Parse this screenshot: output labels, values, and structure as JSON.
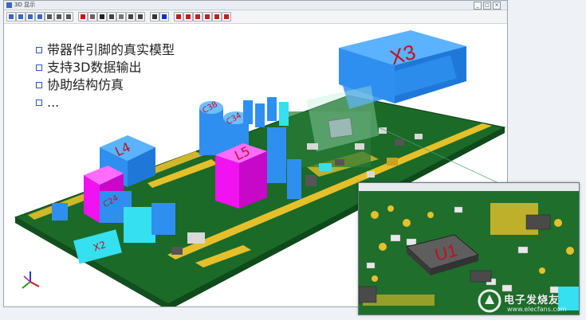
{
  "window": {
    "title": "3D 显示",
    "controls": [
      "_",
      "□",
      "×"
    ]
  },
  "toolbar": {
    "buttons": [
      {
        "name": "zoom-in-icon",
        "color": "#3a67c8"
      },
      {
        "name": "zoom-out-icon",
        "color": "#3a67c8"
      },
      {
        "name": "zoom-window-icon",
        "color": "#3a67c8"
      },
      {
        "name": "zoom-fit-icon",
        "color": "#3a67c8"
      },
      {
        "name": "pan-icon",
        "color": "#555555"
      },
      {
        "name": "select-icon",
        "color": "#555555"
      },
      {
        "name": "rotate-icon",
        "color": "#555555"
      },
      {
        "name": "color-red-icon",
        "color": "#d01010"
      },
      {
        "name": "view-box-icon",
        "color": "#666666"
      },
      {
        "name": "shade-icon",
        "color": "#222222"
      },
      {
        "name": "wire-icon",
        "color": "#444444"
      },
      {
        "name": "light-icon",
        "color": "#777777"
      },
      {
        "name": "top-view-icon",
        "color": "#444444"
      },
      {
        "name": "bottom-view-icon",
        "color": "#444444"
      },
      {
        "name": "save-icon",
        "color": "#333333"
      },
      {
        "name": "color-blue-icon",
        "color": "#1030d0"
      },
      {
        "name": "front-view-icon",
        "color": "#c02020"
      },
      {
        "name": "back-view-icon",
        "color": "#c02020"
      },
      {
        "name": "left-view-icon",
        "color": "#c02020"
      },
      {
        "name": "right-view-icon",
        "color": "#c02020"
      },
      {
        "name": "iso-view-icon",
        "color": "#c02020"
      },
      {
        "name": "export-icon",
        "color": "#c02020"
      }
    ]
  },
  "bullets": [
    "带器件引脚的真实模型",
    "支持3D数据输出",
    "协助结构仿真",
    "..."
  ],
  "components": {
    "x3": "X3",
    "l4": "L4",
    "l5": "L5",
    "c38": "C38",
    "c34": "C34",
    "c24": "C24",
    "x2": "X2",
    "u1": "U1"
  },
  "watermark": {
    "title": "电子发烧友",
    "sub": "www.elecfans.com"
  },
  "colors": {
    "board": "#1f6e2c",
    "copper": "#e8c42a",
    "component_blue": "#2f8ff0",
    "component_cyan": "#35e0f0",
    "inductor_magenta": "#f012f0",
    "bullet_border": "#2456c8"
  }
}
